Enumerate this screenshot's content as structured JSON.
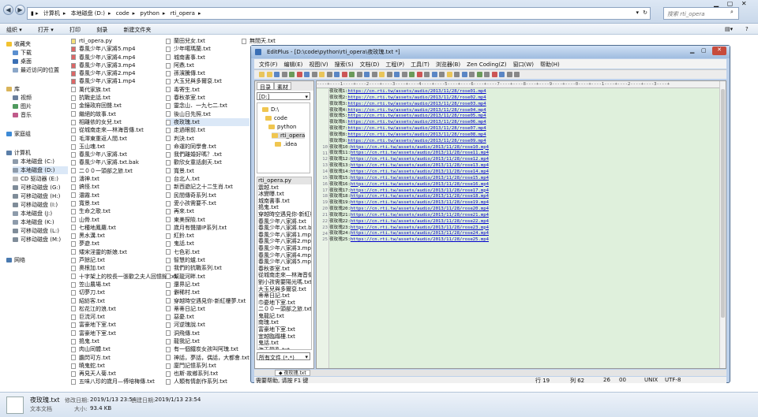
{
  "explorer": {
    "breadcrumbs": [
      "计算机",
      "本地磁盘 (D:)",
      "code",
      "python",
      "rti_opera"
    ],
    "search_placeholder": "搜索 rti_opera",
    "toolbar": [
      "组织 ▾",
      "打开 ▾",
      "打印",
      "刻录",
      "新建文件夹"
    ],
    "nav": {
      "favorites_header": "收藏夹",
      "favorites": [
        "下载",
        "桌面",
        "最近访问的位置"
      ],
      "libraries_header": "库",
      "libraries": [
        "视频",
        "图片",
        "音乐"
      ],
      "homegroup": "家庭组",
      "computer_header": "计算机",
      "drives": [
        "本地磁盘 (C:)",
        "本地磁盘 (D:)",
        "CD 驱动器 (E:)",
        "可移动磁盘 (G:)",
        "可移动磁盘 (H:)",
        "可移动磁盘 (I:)",
        "本地磁盘 (J:)",
        "本地磁盘 (K:)",
        "可移动磁盘 (L:)",
        "可移动磁盘 (M:)"
      ],
      "network": "网络"
    },
    "file_columns": [
      [
        "rti_opera.py",
        "春風少年八家將5.mp4",
        "春風少年八家將4.mp4",
        "春風少年八家將3.mp4",
        "春風少年八家將2.mp4",
        "春風少年八家將1.mp4",
        "萬代家族.txt",
        "抗戰史話.txt",
        "金鐘政府回聲.txt",
        "繼絕的故事.txt",
        "相離依的女兒.txt",
        "從城南走來—林海音傳.txt",
        "毛澤東重返人間.txt",
        "玉山魂.txt",
        "春風少年八家將.txt",
        "春風少年八家將.txt.bak",
        "二００一頭部之旅.txt",
        "濤神.txt",
        "搞怪.txt",
        "濃霧.txt",
        "寬景.txt",
        "生命之歌.txt",
        "山骨.txt",
        "七種地鳳蘿.txt",
        "黑水溝.txt",
        "夢遊.txt",
        "矮宋淫靈的新娘.txt",
        "芦餘記.txt",
        "奧根加.txt",
        "十字架上的校長一張歡之夫人回憶錄.txt",
        "笠山農場.txt",
        "切夢刀.txt",
        "紹紡客.txt",
        "松花江的浪.txt",
        "巨流河.txt",
        "富豪地下室.txt",
        "富豪地下室.txt",
        "搗鬼.txt",
        "肉山同體.txt",
        "膽閃可方.txt",
        "曉鬼蛇.txt",
        "再見天人菊.txt",
        "五味八珍的歲月—傅培梅傳.txt"
      ],
      [
        "蘭田兒女.txt",
        "少年噶瑪蘭.txt",
        "城南書事.txt",
        "阿鼎.txt",
        "孫濱騰傳.txt",
        "大玉兒與多爾袞.txt",
        "毒寄生.txt",
        "春秋茶室.txt",
        "靈念山．一九七二.txt",
        "後山日先照.txt",
        "夜玫瑰.txt",
        "走過眼前.txt",
        "判決.txt",
        "命運的同學會.txt",
        "我們離婚好嗎？.txt",
        "歡欣女童話劇天.txt",
        "寬景.txt",
        "台北人.txt",
        "新西遊記之十二生肖.txt",
        "民間傳奇系列.txt",
        "愛小孩需要不.txt",
        "再來.txt",
        "東美探險.txt",
        "歲月有聲譜IP系列.txt",
        "紅鈴.txt",
        "鬼話.txt",
        "七色彩.txt",
        "智慧的爐.txt",
        "我們的抗戰系列.txt",
        "幫龍河畔.txt",
        "還界記.txt",
        "僻稀村.txt",
        "穿越時空遇見你-新紅樓夢.txt",
        "蒂蒂日記.txt",
        "惡憂.txt",
        "河逆瑰說.txt",
        "洞飛傳.txt",
        "龍我記.txt",
        "有一個鐵炭女孩叫阿瑰.txt",
        "神話，夢話，偶話，大都會.txt",
        "廈門記憶系列.txt",
        "也斯·故鄉系列.txt",
        "人類有情創作系列.txt"
      ],
      [
        "無間天.txt"
      ]
    ],
    "status": {
      "name": "夜玫瑰.txt",
      "type": "文本文档",
      "modified_label": "修改日期:",
      "modified": "2019/1/13 23:54",
      "created_label": "创建日期:",
      "created": "2019/1/13 23:54",
      "size_label": "大小:",
      "size": "93.4 KB"
    }
  },
  "editplus": {
    "title": "EditPlus - [D:\\code\\python\\rti_opera\\夜玫瑰.txt *]",
    "menu": [
      "文件(F)",
      "编辑(E)",
      "视图(V)",
      "搜索(S)",
      "文档(D)",
      "工程(P)",
      "工具(T)",
      "浏览器(B)",
      "Zen Coding(Z)",
      "窗口(W)",
      "帮助(H)"
    ],
    "left_tabs": [
      "目录",
      "素材"
    ],
    "drive": "[D:]",
    "tree": [
      "D:\\",
      "code",
      "python",
      "rti_opera",
      ".idea"
    ],
    "files": [
      "rti_opera.py",
      "震越.txt",
      "冰變曝.txt",
      "城南書事.txt",
      "搗鬼.txt",
      "穿越時空遇見你-新紅樓",
      "春風少年八家將.txt",
      "春風少年八家將.txt.ba",
      "春風少年八家將1.mp4",
      "春風少年八家將2.mp4",
      "春風少年八家將3.mp4",
      "春風少年八家將4.mp4",
      "春風少年八家將5.mp4",
      "春秋茶室.txt",
      "從城南走來—林海音傳",
      "劉小孩需要陽光嗎.txt",
      "大玉兒與多爾袞.txt",
      "蒂蒂日記.txt",
      "巾憂地下室.txt",
      "二００一頭部之旅.txt",
      "鬼龍記.txt",
      "南瑰.txt",
      "富豪地下室.txt",
      "宜越臨蹋樓.txt",
      "鬼話.txt",
      "海天龍亂.txt",
      "歡欣女童武劇天.txt",
      "劉日記.txt"
    ],
    "filter": "所有文件 (*.*)",
    "doc_tab": "夜玫瑰.txt",
    "ruler": "----+----1----+----2----+----3----+----4----+----5----+----6----+----7----+----8----+----9----+----0----+----1----+----2----+----3----+",
    "lines": [
      {
        "n": "",
        "prefix": "夜玫瑰1:",
        "url": "https://cn.rti.tw/assets/audio/2013/11/28/rose01.mp4"
      },
      {
        "n": "",
        "prefix": "夜玫瑰2:",
        "url": "https://cn.rti.tw/assets/audio/2013/11/28/rose02.mp4"
      },
      {
        "n": "",
        "prefix": "夜玫瑰3:",
        "url": "https://cn.rti.tw/assets/audio/2013/11/28/rose03.mp4"
      },
      {
        "n": "",
        "prefix": "夜玫瑰4:",
        "url": "https://cn.rti.tw/assets/audio/2013/11/28/rose04.mp4"
      },
      {
        "n": "",
        "prefix": "夜玫瑰5:",
        "url": "https://cn.rti.tw/assets/audio/2013/11/28/rose05.mp4"
      },
      {
        "n": "",
        "prefix": "夜玫瑰6:",
        "url": "https://cn.rti.tw/assets/audio/2013/11/28/rose06.mp4"
      },
      {
        "n": "",
        "prefix": "夜玫瑰7:",
        "url": "https://cn.rti.tw/assets/audio/2013/11/28/rose07.mp4"
      },
      {
        "n": "",
        "prefix": "夜玫瑰8:",
        "url": "https://cn.rti.tw/assets/audio/2013/11/28/rose08.mp4"
      },
      {
        "n": "",
        "prefix": "夜玫瑰9:",
        "url": "https://cn.rti.tw/assets/audio/2013/11/28/rose09.mp4"
      },
      {
        "n": "10",
        "prefix": "夜玫瑰10:",
        "url": "https://cn.rti.tw/assets/audio/2013/11/28/rose10.mp4"
      },
      {
        "n": "11",
        "prefix": "夜玫瑰11:",
        "url": "https://cn.rti.tw/assets/audio/2013/11/28/rose11.mp4"
      },
      {
        "n": "12",
        "prefix": "夜玫瑰12:",
        "url": "https://cn.rti.tw/assets/audio/2013/11/28/rose12.mp4"
      },
      {
        "n": "13",
        "prefix": "夜玫瑰13:",
        "url": "https://cn.rti.tw/assets/audio/2013/11/28/rose13.mp4"
      },
      {
        "n": "14",
        "prefix": "夜玫瑰14:",
        "url": "https://cn.rti.tw/assets/audio/2013/11/28/rose14.mp4"
      },
      {
        "n": "15",
        "prefix": "夜玫瑰15:",
        "url": "https://cn.rti.tw/assets/audio/2013/11/28/rose15.mp4"
      },
      {
        "n": "16",
        "prefix": "夜玫瑰16:",
        "url": "https://cn.rti.tw/assets/audio/2013/11/28/rose16.mp4"
      },
      {
        "n": "17",
        "prefix": "夜玫瑰17:",
        "url": "https://cn.rti.tw/assets/audio/2013/11/28/rose17.mp4"
      },
      {
        "n": "18",
        "prefix": "夜玫瑰18:",
        "url": "https://cn.rti.tw/assets/audio/2013/11/28/rose18.mp4"
      },
      {
        "n": "19",
        "prefix": "夜玫瑰19:",
        "url": "https://cn.rti.tw/assets/audio/2013/11/28/rose19.mp4"
      },
      {
        "n": "20",
        "prefix": "夜玫瑰20:",
        "url": "https://cn.rti.tw/assets/audio/2013/11/28/rose20.mp4"
      },
      {
        "n": "21",
        "prefix": "夜玫瑰21:",
        "url": "https://cn.rti.tw/assets/audio/2013/11/28/rose21.mp4"
      },
      {
        "n": "22",
        "prefix": "夜玫瑰22:",
        "url": "https://cn.rti.tw/assets/audio/2013/11/28/rose22.mp4"
      },
      {
        "n": "23",
        "prefix": "夜玫瑰23:",
        "url": "https://cn.rti.tw/assets/audio/2013/11/28/rose23.mp4"
      },
      {
        "n": "24",
        "prefix": "夜玫瑰24:",
        "url": "https://cn.rti.tw/assets/audio/2013/11/28/rose24.mp4"
      },
      {
        "n": "25",
        "prefix": "夜玫瑰25:",
        "url": "https://cn.rti.tw/assets/audio/2013/11/28/rose25.mp4"
      }
    ],
    "statusbar": {
      "help": "需要帮助, 请按 F1 键",
      "row": "行 19",
      "col": "列 62",
      "n1": "26",
      "n2": "00",
      "eol": "UNIX",
      "encoding": "UTF-8"
    }
  },
  "colors": {
    "editor_bg": "#dff0dc",
    "link": "#0000cc",
    "titlebar": "#9fbcdf",
    "folder": "#f0c650"
  }
}
